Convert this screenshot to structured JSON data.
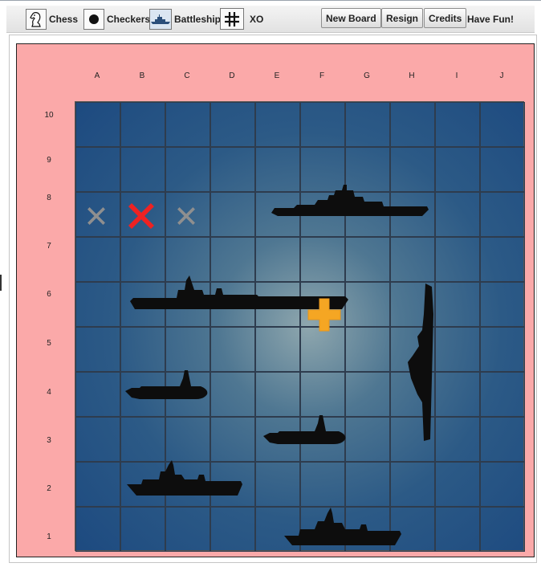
{
  "toolbar": {
    "games": [
      {
        "id": "chess",
        "label": "Chess",
        "icon": "chess-knight-icon"
      },
      {
        "id": "checkers",
        "label": "Checkers",
        "icon": "checker-disc-icon"
      },
      {
        "id": "battleship",
        "label": "Battleship",
        "icon": "battleship-icon"
      },
      {
        "id": "xo",
        "label": "XO",
        "icon": "tic-tac-toe-grid-icon"
      }
    ],
    "buttons": {
      "new_board": "New Board",
      "resign": "Resign",
      "credits": "Credits"
    },
    "tagline": "Have Fun!"
  },
  "board": {
    "columns": [
      "A",
      "B",
      "C",
      "D",
      "E",
      "F",
      "G",
      "H",
      "I",
      "J"
    ],
    "rows": [
      "10",
      "9",
      "8",
      "7",
      "6",
      "5",
      "4",
      "3",
      "2",
      "1"
    ],
    "colors": {
      "background": "#fba9a9",
      "ocean": "#2c5a86",
      "grid_line": "#2e3c4e",
      "hit": "#ee2222",
      "miss": "#8f8f8f",
      "target": "#f5a623"
    },
    "misses": [
      {
        "col": "A",
        "row": "8"
      },
      {
        "col": "C",
        "row": "8"
      }
    ],
    "hits": [
      {
        "col": "B",
        "row": "8"
      }
    ],
    "target": {
      "col": "F",
      "row": "6"
    },
    "ships": [
      {
        "name": "battleship",
        "orientation": "horizontal",
        "cells": [
          "E8",
          "F8",
          "G8",
          "H8"
        ]
      },
      {
        "name": "aircraft-carrier",
        "orientation": "horizontal",
        "cells": [
          "B6",
          "C6",
          "D6",
          "E6",
          "F6"
        ]
      },
      {
        "name": "cruiser",
        "orientation": "vertical",
        "cells": [
          "H6",
          "H5",
          "H4",
          "H3"
        ]
      },
      {
        "name": "submarine",
        "orientation": "horizontal",
        "cells": [
          "B4",
          "C4"
        ]
      },
      {
        "name": "submarine",
        "orientation": "horizontal",
        "cells": [
          "E3",
          "F3"
        ]
      },
      {
        "name": "destroyer",
        "orientation": "horizontal",
        "cells": [
          "B2",
          "C2",
          "D2"
        ]
      },
      {
        "name": "destroyer",
        "orientation": "horizontal",
        "cells": [
          "E1",
          "F1",
          "G1"
        ]
      }
    ]
  }
}
